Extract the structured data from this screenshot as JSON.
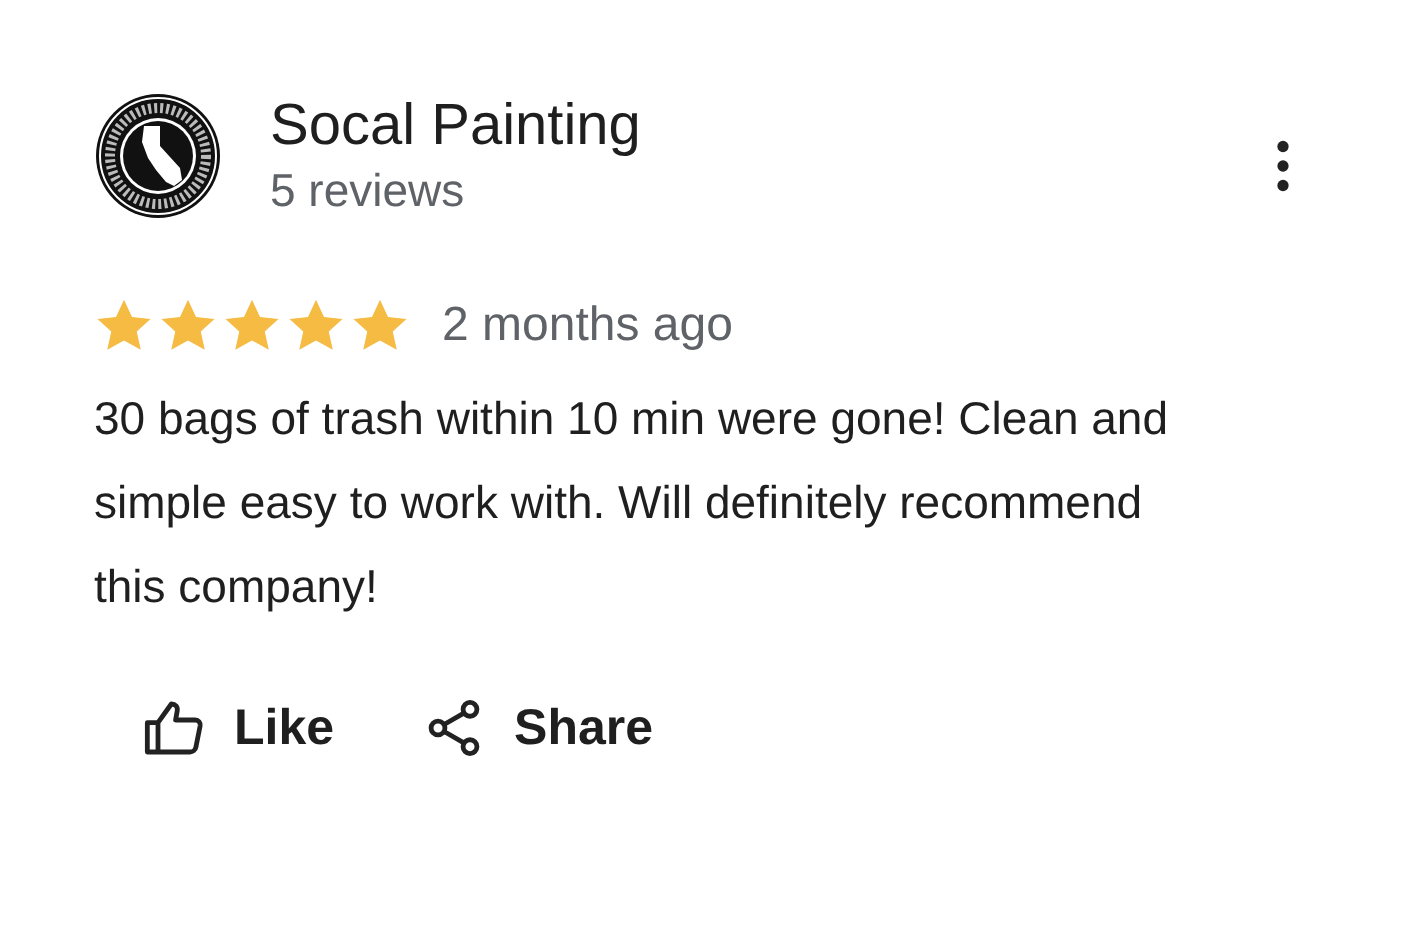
{
  "reviewer": {
    "name": "Socal Painting",
    "reviews": "5 reviews"
  },
  "review": {
    "stars": 5,
    "time": "2 months ago",
    "text": "30 bags of trash within 10 min were gone! Clean and simple easy to work with. Will definitely recommend this company!"
  },
  "actions": [
    {
      "kind": "like",
      "label": "Like"
    },
    {
      "kind": "share",
      "label": "Share"
    }
  ]
}
